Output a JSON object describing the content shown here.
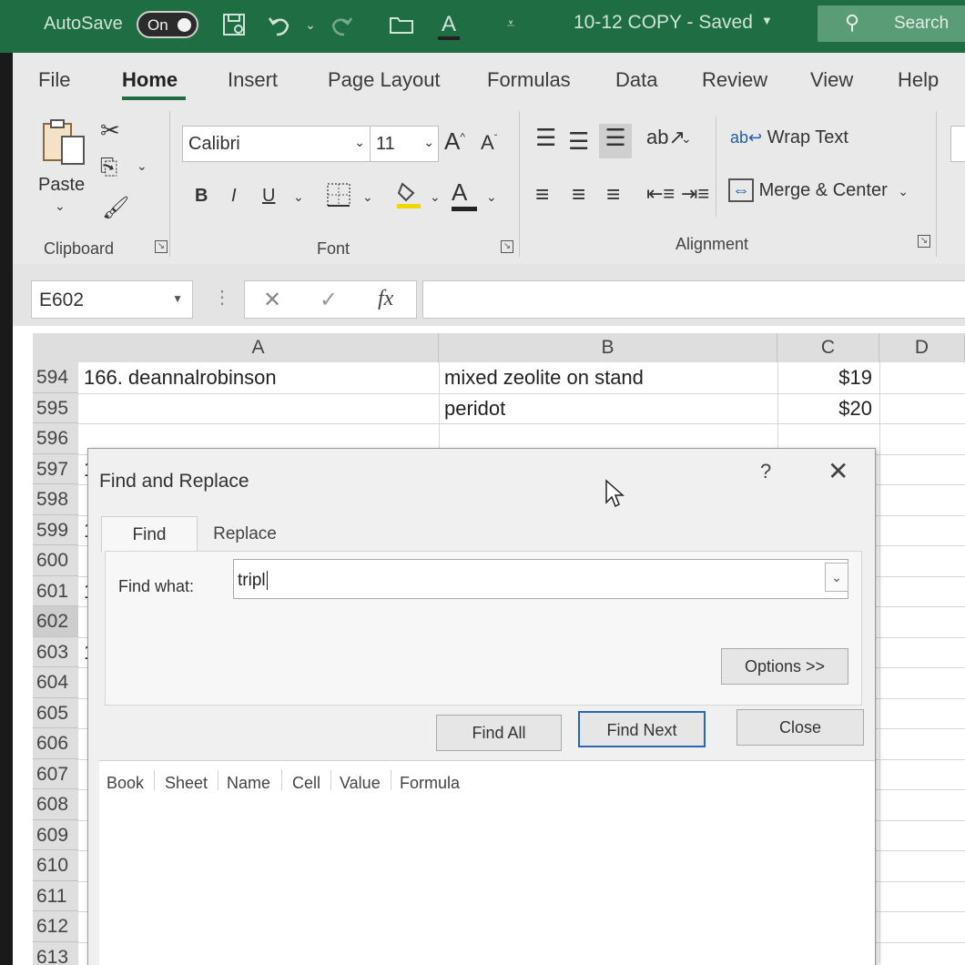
{
  "titlebar": {
    "autosave_label": "AutoSave",
    "autosave_state": "On",
    "doc_title": "10-12 COPY  -  Saved",
    "search_label": "Search",
    "font_color_letter": "A"
  },
  "ribbon": {
    "tabs": [
      "File",
      "Home",
      "Insert",
      "Page Layout",
      "Formulas",
      "Data",
      "Review",
      "View",
      "Help"
    ],
    "active_tab": "Home",
    "clipboard": {
      "paste_label": "Paste",
      "group_label": "Clipboard"
    },
    "font": {
      "font_name": "Calibri",
      "font_size": "11",
      "bold": "B",
      "italic": "I",
      "underline": "U",
      "grow": "A",
      "shrink": "A",
      "group_label": "Font",
      "highlight_color": "#f2d600",
      "font_color": "#c00000"
    },
    "alignment": {
      "wrap_text": "Wrap Text",
      "merge_center": "Merge & Center",
      "group_label": "Alignment"
    }
  },
  "formula_bar": {
    "name_box": "E602",
    "fx": "fx",
    "cancel": "✕",
    "enter": "✓",
    "more": "⋮",
    "content": ""
  },
  "grid": {
    "columns": [
      "A",
      "B",
      "C",
      "D"
    ],
    "rows": [
      {
        "num": "594",
        "a": "166. deannalrobinson",
        "b": "mixed zeolite on stand",
        "c": "$19"
      },
      {
        "num": "595",
        "a": "",
        "b": "peridot",
        "c": "$20"
      },
      {
        "num": "596",
        "a": "",
        "b": "",
        "c": ""
      },
      {
        "num": "597",
        "a": "1",
        "b": "",
        "c": ""
      },
      {
        "num": "598",
        "a": "",
        "b": "",
        "c": ""
      },
      {
        "num": "599",
        "a": "1",
        "b": "",
        "c": ""
      },
      {
        "num": "600",
        "a": "",
        "b": "",
        "c": ""
      },
      {
        "num": "601",
        "a": "1",
        "b": "",
        "c": ""
      },
      {
        "num": "602",
        "a": "",
        "b": "",
        "c": ""
      },
      {
        "num": "603",
        "a": "1",
        "b": "",
        "c": ""
      },
      {
        "num": "604",
        "a": "",
        "b": "",
        "c": ""
      },
      {
        "num": "605",
        "a": "",
        "b": "",
        "c": ""
      },
      {
        "num": "606",
        "a": "",
        "b": "",
        "c": ""
      },
      {
        "num": "607",
        "a": "",
        "b": "",
        "c": ""
      },
      {
        "num": "608",
        "a": "",
        "b": "",
        "c": ""
      },
      {
        "num": "609",
        "a": "",
        "b": "",
        "c": ""
      },
      {
        "num": "610",
        "a": "",
        "b": "",
        "c": ""
      },
      {
        "num": "611",
        "a": "",
        "b": "",
        "c": ""
      },
      {
        "num": "612",
        "a": "",
        "b": "",
        "c": ""
      },
      {
        "num": "613",
        "a": "",
        "b": "",
        "c": ""
      }
    ]
  },
  "dialog": {
    "title": "Find and Replace",
    "help": "?",
    "close": "✕",
    "tabs": [
      "Find",
      "Replace"
    ],
    "active_tab": "Find",
    "find_what_label": "Find what:",
    "find_what_value": "tripl",
    "options_button": "Options >>",
    "find_all_button": "Find All",
    "find_next_button": "Find Next",
    "close_button": "Close",
    "result_columns": [
      "Book",
      "Sheet",
      "Name",
      "Cell",
      "Value",
      "Formula"
    ]
  }
}
